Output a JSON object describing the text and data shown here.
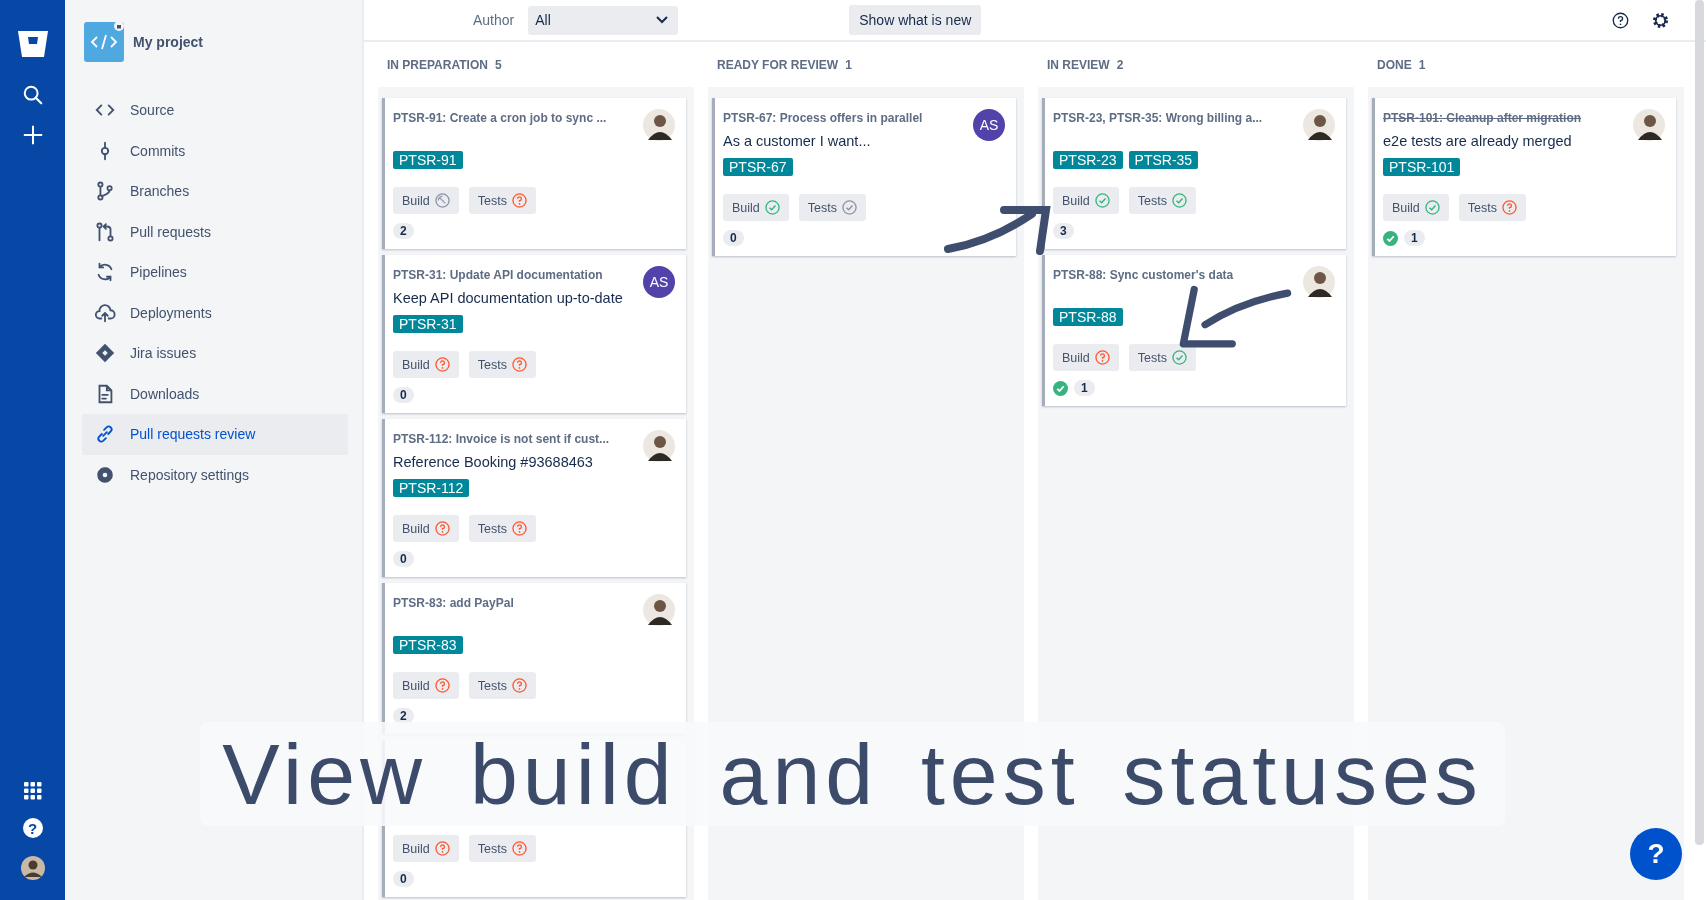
{
  "rail": {
    "help": "?"
  },
  "project": {
    "name": "My project"
  },
  "sidebar": {
    "items": [
      {
        "label": "Source",
        "selected": false
      },
      {
        "label": "Commits",
        "selected": false
      },
      {
        "label": "Branches",
        "selected": false
      },
      {
        "label": "Pull requests",
        "selected": false
      },
      {
        "label": "Pipelines",
        "selected": false
      },
      {
        "label": "Deployments",
        "selected": false
      },
      {
        "label": "Jira issues",
        "selected": false
      },
      {
        "label": "Downloads",
        "selected": false
      },
      {
        "label": "Pull requests review",
        "selected": true
      },
      {
        "label": "Repository settings",
        "selected": false
      }
    ]
  },
  "toolbar": {
    "author_label": "Author",
    "author_value": "All",
    "new_button": "Show what is new"
  },
  "columns": [
    {
      "title": "IN PREPARATION",
      "count": "5",
      "cards": [
        {
          "title": "PTSR-91: Create a cron job to sync ...",
          "struck": false,
          "tags": [
            "PTSR-91"
          ],
          "avatar": {
            "kind": "photo"
          },
          "chips": [
            {
              "label": "Build",
              "kind": "skipped"
            },
            {
              "label": "Tests",
              "kind": "unknown"
            }
          ],
          "approved": false,
          "comments": "2"
        },
        {
          "title": "PTSR-31: Update API documentation",
          "struck": false,
          "description": "Keep API documentation up-to-date",
          "tags": [
            "PTSR-31"
          ],
          "avatar": {
            "kind": "initials",
            "text": "AS"
          },
          "chips": [
            {
              "label": "Build",
              "kind": "unknown"
            },
            {
              "label": "Tests",
              "kind": "unknown"
            }
          ],
          "approved": false,
          "comments": "0"
        },
        {
          "title": "PTSR-112: Invoice is not sent if cust...",
          "struck": false,
          "description": "Reference Booking #93688463",
          "tags": [
            "PTSR-112"
          ],
          "avatar": {
            "kind": "photo"
          },
          "chips": [
            {
              "label": "Build",
              "kind": "unknown"
            },
            {
              "label": "Tests",
              "kind": "unknown"
            }
          ],
          "approved": false,
          "comments": "0"
        },
        {
          "title": "PTSR-83: add PayPal",
          "struck": false,
          "tags": [
            "PTSR-83"
          ],
          "avatar": {
            "kind": "photo"
          },
          "chips": [
            {
              "label": "Build",
              "kind": "unknown"
            },
            {
              "label": "Tests",
              "kind": "unknown"
            }
          ],
          "approved": false,
          "comments": "2"
        },
        {
          "chips": [
            {
              "label": "Build",
              "kind": "unknown"
            },
            {
              "label": "Tests",
              "kind": "unknown"
            }
          ],
          "approved": false,
          "comments": "0"
        }
      ]
    },
    {
      "title": "READY FOR REVIEW",
      "count": "1",
      "cards": [
        {
          "title": "PTSR-67: Process offers in parallel",
          "struck": false,
          "description": "As a customer I want...",
          "tags": [
            "PTSR-67"
          ],
          "avatar": {
            "kind": "initials",
            "text": "AS"
          },
          "chips": [
            {
              "label": "Build",
              "kind": "success"
            },
            {
              "label": "Tests",
              "kind": "neutral"
            }
          ],
          "approved": false,
          "comments": "0"
        }
      ]
    },
    {
      "title": "IN REVIEW",
      "count": "2",
      "cards": [
        {
          "title": "PTSR-23, PTSR-35: Wrong billing a...",
          "struck": false,
          "tags": [
            "PTSR-23",
            "PTSR-35"
          ],
          "avatar": {
            "kind": "photo"
          },
          "chips": [
            {
              "label": "Build",
              "kind": "success"
            },
            {
              "label": "Tests",
              "kind": "success"
            }
          ],
          "approved": false,
          "comments": "3"
        },
        {
          "title": "PTSR-88: Sync customer's data",
          "struck": false,
          "tags": [
            "PTSR-88"
          ],
          "avatar": {
            "kind": "photo"
          },
          "chips": [
            {
              "label": "Build",
              "kind": "unknown"
            },
            {
              "label": "Tests",
              "kind": "success"
            }
          ],
          "approved": true,
          "comments": "1"
        }
      ]
    },
    {
      "title": "DONE",
      "count": "1",
      "cards": [
        {
          "title": "PTSR-101: Cleanup after migration",
          "struck": true,
          "description": "e2e tests are already merged",
          "tags": [
            "PTSR-101"
          ],
          "avatar": {
            "kind": "photo"
          },
          "chips": [
            {
              "label": "Build",
              "kind": "success"
            },
            {
              "label": "Tests",
              "kind": "unknown"
            }
          ],
          "approved": true,
          "comments": "1"
        }
      ]
    }
  ],
  "caption": "View build and test statuses",
  "help_button": "?"
}
